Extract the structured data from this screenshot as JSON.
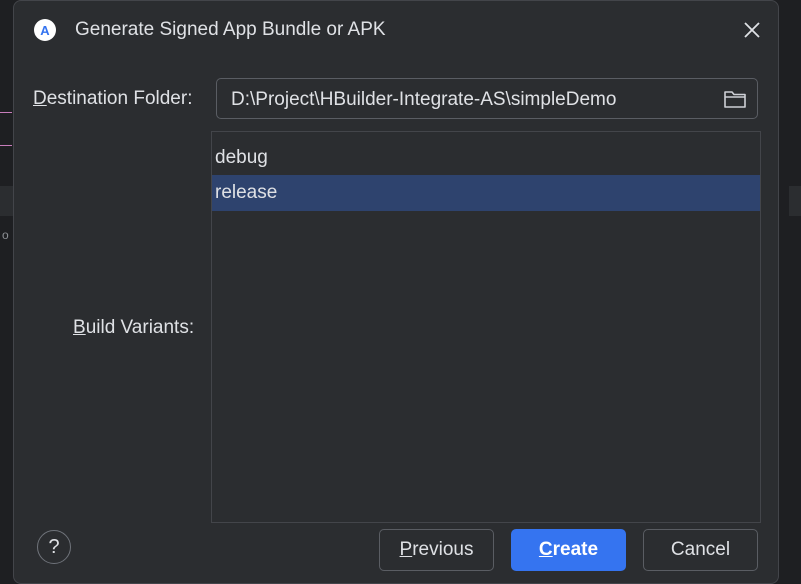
{
  "dialog": {
    "title": "Generate Signed App Bundle or APK",
    "app_icon_letter": "A"
  },
  "destination": {
    "label_mnemonic": "D",
    "label_rest": "estination Folder:",
    "value": "D:\\Project\\HBuilder-Integrate-AS\\simpleDemo"
  },
  "build_variants": {
    "label_mnemonic": "B",
    "label_rest": "uild Variants:",
    "items": [
      {
        "label": "debug",
        "selected": false
      },
      {
        "label": "release",
        "selected": true
      }
    ]
  },
  "footer": {
    "help_label": "?",
    "previous_mnemonic": "P",
    "previous_rest": "revious",
    "create_mnemonic": "C",
    "create_rest": "reate",
    "cancel_label": "Cancel"
  },
  "colors": {
    "dialog_bg": "#2b2d30",
    "accent": "#3574f0",
    "selection": "#2e436e",
    "text": "#dfe1e5"
  }
}
